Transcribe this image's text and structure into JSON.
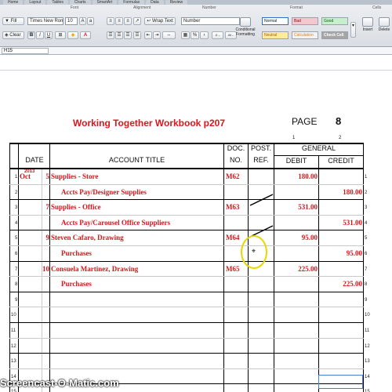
{
  "ribbon": {
    "tabs": [
      "Home",
      "Layout",
      "Tables",
      "Charts",
      "SmartArt",
      "Formulas",
      "Data",
      "Review"
    ],
    "groups": {
      "font": "Font",
      "alignment": "Alignment",
      "number": "Number",
      "format": "Format",
      "cells": "Cells"
    },
    "fill_label": "Fill",
    "clear_label": "Clear",
    "font_name": "Times New Roman",
    "font_size": "10",
    "wrap_text_label": "Wrap Text",
    "number_format": "Number",
    "styles": {
      "normal": "Normal",
      "bad": "Bad",
      "good": "Good",
      "neutral": "Neutral",
      "calculation": "Calculation",
      "check_cell": "Check Cell"
    },
    "conditional_formatting_label": "Conditional Formatting",
    "insert_label": "Insert",
    "delete_label": "Delete",
    "colors": {
      "bad_bg": "#f4c7ce",
      "good_bg": "#c6efce",
      "neutral_bg": "#ffeb9c",
      "calc_bg": "#f2f2f2",
      "check_bg": "#a5a5a5"
    }
  },
  "formula_bar": {
    "name_box": "H15"
  },
  "sheet": {
    "title": "Working Together Workbook p207",
    "page_label": "PAGE",
    "page_number": "8",
    "col_marker_1": "1",
    "col_marker_2": "2",
    "headers": {
      "date": "DATE",
      "account_title": "ACCOUNT TITLE",
      "doc_no_1": "DOC.",
      "doc_no_2": "NO.",
      "post_ref_1": "POST.",
      "post_ref_2": "REF.",
      "general": "GENERAL",
      "debit": "DEBIT",
      "credit": "CREDIT"
    },
    "year": "2013",
    "rows": [
      {
        "n": "1",
        "month": "Oct",
        "day": "5",
        "account": "Supplies - Store",
        "doc": "M62",
        "debit": "180.00",
        "credit": ""
      },
      {
        "n": "2",
        "month": "",
        "day": "",
        "account": "Accts Pay/Designer Supplies",
        "doc": "",
        "debit": "",
        "credit": "180.00"
      },
      {
        "n": "3",
        "month": "",
        "day": "7",
        "account": "Supplies - Office",
        "doc": "M63",
        "debit": "531.00",
        "credit": ""
      },
      {
        "n": "4",
        "month": "",
        "day": "",
        "account": "Accts Pay/Carousel Office Suppliers",
        "doc": "",
        "debit": "",
        "credit": "531.00"
      },
      {
        "n": "5",
        "month": "",
        "day": "9",
        "account": "Steven Cafaro, Drawing",
        "doc": "M64",
        "debit": "95.00",
        "credit": ""
      },
      {
        "n": "6",
        "month": "",
        "day": "",
        "account": "Purchases",
        "doc": "",
        "debit": "",
        "credit": "95.00"
      },
      {
        "n": "7",
        "month": "",
        "day": "10",
        "account": "Consuela Martinez, Drawing",
        "doc": "M65",
        "debit": "225.00",
        "credit": ""
      },
      {
        "n": "8",
        "month": "",
        "day": "",
        "account": "Purchases",
        "doc": "",
        "debit": "",
        "credit": "225.00"
      },
      {
        "n": "9"
      },
      {
        "n": "10"
      },
      {
        "n": "11"
      },
      {
        "n": "12"
      },
      {
        "n": "13"
      },
      {
        "n": "14"
      },
      {
        "n": "15"
      }
    ],
    "accent": "#d8161b"
  },
  "watermark": "Screencast-O-Matic.com"
}
